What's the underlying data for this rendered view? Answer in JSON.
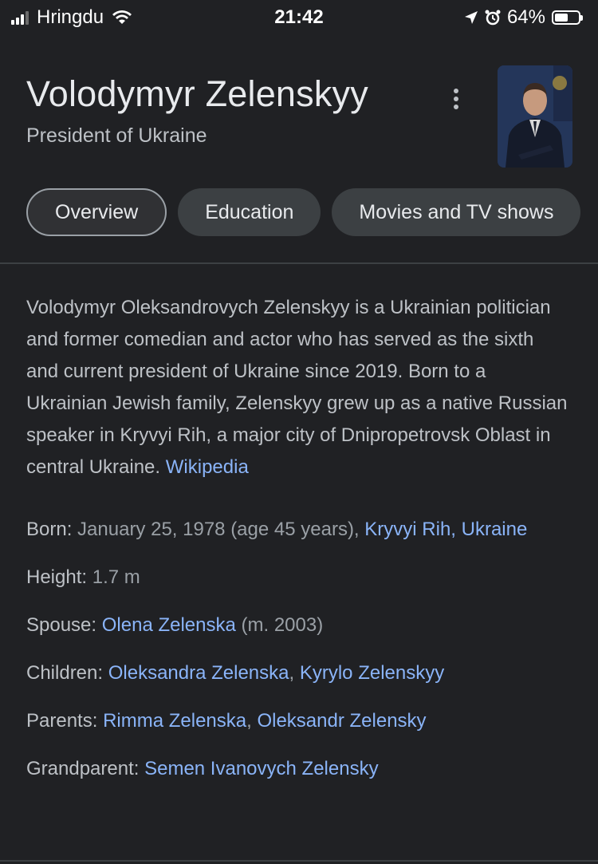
{
  "status_bar": {
    "carrier": "Hringdu",
    "time": "21:42",
    "battery_percent": "64%",
    "battery_level": 0.64,
    "icons": [
      "signal-icon",
      "wifi-icon",
      "location-arrow-icon",
      "alarm-icon",
      "battery-icon"
    ]
  },
  "header": {
    "title": "Volodymyr Zelenskyy",
    "subtitle": "President of Ukraine"
  },
  "tabs": [
    {
      "label": "Overview",
      "active": true
    },
    {
      "label": "Education",
      "active": false
    },
    {
      "label": "Movies and TV shows",
      "active": false
    }
  ],
  "description": {
    "text": "Volodymyr Oleksandrovych Zelenskyy is a Ukrainian politician and former comedian and actor who has served as the sixth and current president of Ukraine since 2019. Born to a Ukrainian Jewish family, Zelenskyy grew up as a native Russian speaker in Kryvyi Rih, a major city of Dnipropetrovsk Oblast in central Ukraine.",
    "source_link": "Wikipedia"
  },
  "facts": {
    "born": {
      "label": "Born:",
      "value": "January 25, 1978 (age 45 years),",
      "link": "Kryvyi Rih, Ukraine"
    },
    "height": {
      "label": "Height:",
      "value": "1.7 m"
    },
    "spouse": {
      "label": "Spouse:",
      "link": "Olena Zelenska",
      "value": "(m. 2003)"
    },
    "children": {
      "label": "Children:",
      "link1": "Oleksandra Zelenska",
      "sep": ",",
      "link2": "Kyrylo Zelenskyy"
    },
    "parents": {
      "label": "Parents:",
      "link1": "Rimma Zelenska",
      "sep": ",",
      "link2": "Oleksandr Zelensky"
    },
    "grandparent": {
      "label": "Grandparent:",
      "link": "Semen Ivanovych Zelensky"
    }
  },
  "colors": {
    "background": "#202124",
    "text_primary": "#e8eaed",
    "text_secondary": "#bdc1c6",
    "link": "#8ab4f8",
    "chip": "#3c4043"
  }
}
